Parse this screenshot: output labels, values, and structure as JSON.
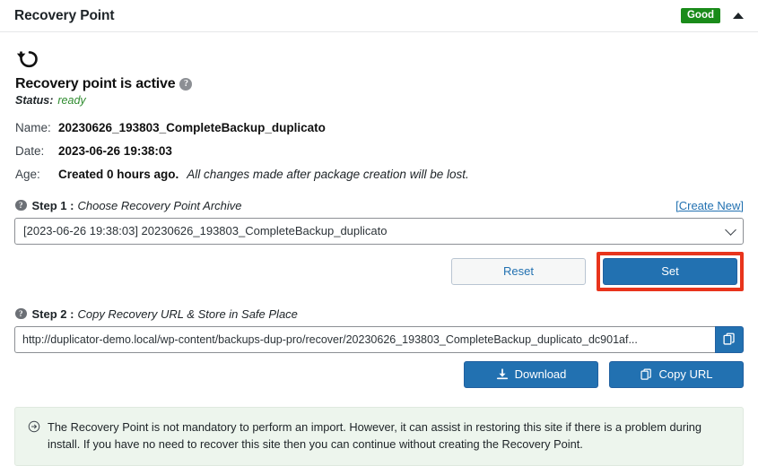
{
  "header": {
    "title": "Recovery Point",
    "status_badge": "Good",
    "collapse_icon": "caret-up-icon",
    "badge_color": "#1a8b1a"
  },
  "summary": {
    "restore_icon": "restore-arrow-icon",
    "title": "Recovery point is active",
    "title_help_icon": "help-circle-icon",
    "status_label": "Status:",
    "status_value": "ready",
    "status_color": "#2e8b2e"
  },
  "meta": {
    "rows": [
      {
        "label": "Name:",
        "value": "20230626_193803_CompleteBackup_duplicato",
        "note": ""
      },
      {
        "label": "Date:",
        "value": "2023-06-26 19:38:03",
        "note": ""
      },
      {
        "label": "Age:",
        "value": "Created 0 hours ago.",
        "note": "All changes made after package creation will be lost."
      }
    ]
  },
  "step1": {
    "help_icon": "help-circle-icon",
    "label": "Step 1 :",
    "description": "Choose Recovery Point Archive",
    "create_new_link": "[Create New]",
    "select_value": "[2023-06-26 19:38:03] 20230626_193803_CompleteBackup_duplicato",
    "select_options": [
      "[2023-06-26 19:38:03] 20230626_193803_CompleteBackup_duplicato"
    ],
    "chevron_icon": "chevron-down-icon",
    "reset_button": "Reset",
    "set_button": "Set",
    "highlight_color": "#e8341c"
  },
  "step2": {
    "help_icon": "help-circle-icon",
    "label": "Step 2 :",
    "description": "Copy Recovery URL & Store in Safe Place",
    "url_value": "http://duplicator-demo.local/wp-content/backups-dup-pro/recover/20230626_193803_CompleteBackup_duplicato_dc901af...",
    "copy_field_icon": "copy-icon",
    "download_button": "Download",
    "download_icon": "download-icon",
    "copy_url_button": "Copy URL",
    "copy_url_icon": "copy-icon"
  },
  "notice": {
    "icon": "arrow-circle-right-icon",
    "text": "The Recovery Point is not mandatory to perform an import. However, it can assist in restoring this site if there is a problem during install. If you have no need to recover this site then you can continue without creating the Recovery Point.",
    "background_color": "#edf5ed"
  }
}
